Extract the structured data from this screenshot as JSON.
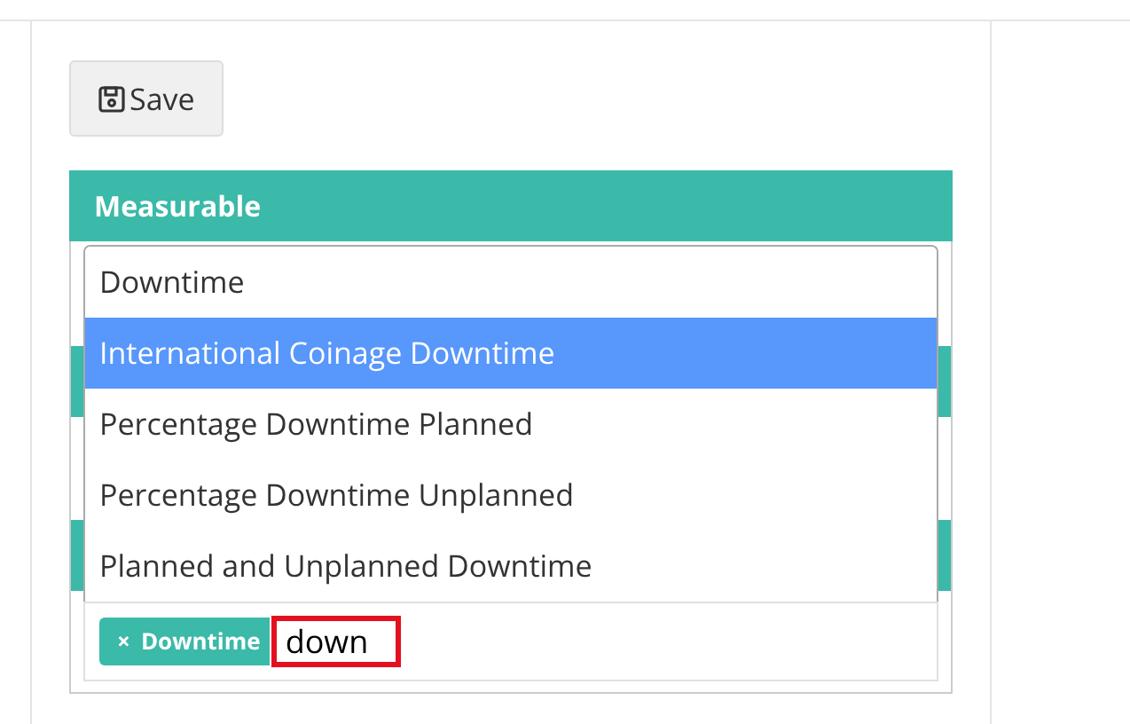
{
  "save_button": {
    "label": "Save"
  },
  "panel": {
    "title": "Measurable"
  },
  "dropdown": {
    "options": [
      {
        "label": "Downtime",
        "selected": false
      },
      {
        "label": "International Coinage Downtime",
        "selected": true
      },
      {
        "label": "Percentage Downtime Planned",
        "selected": false
      },
      {
        "label": "Percentage Downtime Unplanned",
        "selected": false
      },
      {
        "label": "Planned and Unplanned Downtime",
        "selected": false
      }
    ]
  },
  "tag_input": {
    "tags": [
      {
        "remove": "×",
        "label": "Downtime"
      }
    ],
    "value": "down"
  }
}
